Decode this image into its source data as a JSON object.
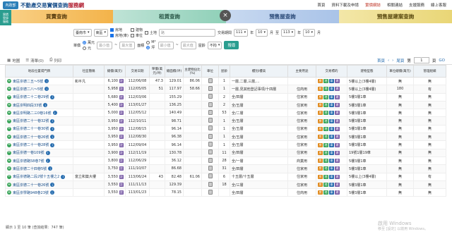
{
  "header": {
    "logo_text": "內政部",
    "title": "不動產交易實價查詢",
    "title_suffix": "服務網",
    "nav": [
      "首頁",
      "資料下載及申請",
      "實價網誌",
      "相關連結",
      "支援服務",
      "線上客服"
    ]
  },
  "tabs": [
    "買賣查詢",
    "租賃查詢",
    "預售屋查詢",
    "預售屋建案查詢"
  ],
  "side_badge": [
    "實價",
    "登錄",
    "服務"
  ],
  "filters": {
    "city": "臺南市",
    "district": "東區",
    "type_options": [
      "房地",
      "房地(車)",
      "建物",
      "車位",
      "土地"
    ],
    "type_checked": [
      true,
      true,
      false,
      false,
      false
    ],
    "address_placeholder": "路",
    "period_label": "交易期間",
    "year_from": "111",
    "month_from": "10",
    "year_to": "113",
    "month_to": "10",
    "year_unit": "年",
    "month_unit": "月",
    "to": "至",
    "unit_price_label": "單價",
    "unit_options": [
      "萬元",
      "元"
    ],
    "min_placeholder": "最小值",
    "max_placeholder": "最大值",
    "area_label": "面積",
    "area_units": [
      "M²",
      "坪"
    ],
    "age_label": "屋齡",
    "age_value": "不拘",
    "search_button": "搜尋"
  },
  "toolbar": {
    "map": "地圖",
    "list": "清單(0)",
    "print": "列印",
    "first": "首頁",
    "last": "尾頁",
    "page_label": "第",
    "page_value": "1",
    "page_unit": "頁",
    "go": "GO"
  },
  "table": {
    "headers": [
      "地段位置或門牌",
      "社區簡稱",
      "總價(萬元)",
      "交易日期",
      "單價(萬元/坪)",
      "總面積(坪)",
      "主建物佔比(%)",
      "車位",
      "屋齡",
      "樓別/樓高",
      "主要用途",
      "交易標的",
      "建物型態",
      "車位總價(萬元)",
      "管理組織"
    ],
    "rows": [
      {
        "addr": "東區崇德二五～5號",
        "comm": "和平凡",
        "total": "6,100",
        "date": "112/06/08",
        "unit": "47.3",
        "area": "129.01",
        "ratio": "86.06",
        "park": "",
        "age": "1",
        "floor": "一層,二層,三層,...",
        "use": "",
        "badges": [
          "房",
          "地",
          "車",
          "建"
        ],
        "type": "5樓以上(3樓4層)",
        "ptotal": "無",
        "mgmt": "無"
      },
      {
        "addr": "東區崇德二八～5號",
        "comm": "",
        "total": "5,958",
        "date": "112/05/05",
        "unit": "51",
        "area": "117.97",
        "ratio": "58.66",
        "park": "",
        "age": "1",
        "floor": "一層,見其他登記事項/十四層",
        "use": "住商用",
        "badges": [
          "房",
          "地",
          "車",
          "建"
        ],
        "type": "5樓以上(3樓4層)",
        "ptotal": "180",
        "mgmt": "有"
      },
      {
        "addr": "東區崇德二十二巷29號",
        "comm": "",
        "total": "5,680",
        "date": "112/03/06",
        "unit": "",
        "area": "155.29",
        "ratio": "",
        "park": "",
        "age": "2",
        "floor": "全/四層",
        "use": "住家用",
        "badges": [
          "房",
          "地",
          "車",
          "建"
        ],
        "type": "5樓3層1車",
        "ptotal": "無",
        "mgmt": "無"
      },
      {
        "addr": "東區崇明四段33號",
        "comm": "",
        "total": "5,400",
        "date": "113/01/27",
        "unit": "",
        "area": "136.25",
        "ratio": "",
        "park": "",
        "age": "2",
        "floor": "全/五層",
        "use": "住家用",
        "badges": [
          "房",
          "地",
          "車",
          "建"
        ],
        "type": "5樓3層1車",
        "ptotal": "無",
        "mgmt": "無"
      },
      {
        "addr": "東區崇明路二三0巷16號",
        "comm": "",
        "total": "5,000",
        "date": "112/05/12",
        "unit": "",
        "area": "140.49",
        "ratio": "",
        "park": "",
        "age": "53",
        "floor": "全/二層",
        "use": "住家用",
        "badges": [
          "房",
          "地",
          "車",
          "建"
        ],
        "type": "5樓3層1車",
        "ptotal": "無",
        "mgmt": "無"
      },
      {
        "addr": "東區崇德二十一巷32號",
        "comm": "",
        "total": "3,950",
        "date": "112/10/11",
        "unit": "",
        "area": "98.71",
        "ratio": "",
        "park": "",
        "age": "1",
        "floor": "全/五層",
        "use": "住家用",
        "badges": [
          "房",
          "地",
          "車",
          "建"
        ],
        "type": "5樓3層1車",
        "ptotal": "無",
        "mgmt": "無"
      },
      {
        "addr": "東區崇德二十一巷30號",
        "comm": "",
        "total": "3,950",
        "date": "112/08/15",
        "unit": "",
        "area": "96.14",
        "ratio": "",
        "park": "",
        "age": "1",
        "floor": "全/五層",
        "use": "住家用",
        "badges": [
          "房",
          "地",
          "車",
          "建"
        ],
        "type": "5樓3層1車",
        "ptotal": "無",
        "mgmt": "無"
      },
      {
        "addr": "東區崇德二十一巷26號",
        "comm": "",
        "total": "3,950",
        "date": "112/08/30",
        "unit": "",
        "area": "96.38",
        "ratio": "",
        "park": "",
        "age": "1",
        "floor": "全/五層",
        "use": "住家用",
        "badges": [
          "房",
          "地",
          "車",
          "建"
        ],
        "type": "5樓3層1車",
        "ptotal": "無",
        "mgmt": "無"
      },
      {
        "addr": "東區崇德二十一巷28號",
        "comm": "",
        "total": "3,950",
        "date": "112/09/04",
        "unit": "",
        "area": "96.14",
        "ratio": "",
        "park": "",
        "age": "1",
        "floor": "全/五層",
        "use": "住家用",
        "badges": [
          "房",
          "地",
          "車",
          "建"
        ],
        "type": "5樓3層1車",
        "ptotal": "無",
        "mgmt": "無"
      },
      {
        "addr": "東區崇德一巷109號",
        "comm": "",
        "total": "3,900",
        "date": "112/11/19",
        "unit": "",
        "area": "130.78",
        "ratio": "",
        "park": "",
        "age": "11",
        "floor": "全/四層",
        "use": "住家用",
        "badges": [
          "房",
          "地",
          "車",
          "建"
        ],
        "type": "19號1層19車",
        "ptotal": "無",
        "mgmt": "無"
      },
      {
        "addr": "東區崇德路58巷7號",
        "comm": "",
        "total": "3,800",
        "date": "112/06/29",
        "unit": "",
        "area": "36.12",
        "ratio": "",
        "park": "",
        "age": "28",
        "floor": "全/一層",
        "use": "商業用",
        "badges": [
          "房",
          "地",
          "車",
          "建"
        ],
        "type": "5樓3層1車",
        "ptotal": "無",
        "mgmt": "無"
      },
      {
        "addr": "東區崇德二十四巷5號",
        "comm": "",
        "total": "3,750",
        "date": "111/10/07",
        "unit": "",
        "area": "86.68",
        "ratio": "",
        "park": "",
        "age": "31",
        "floor": "全/四層",
        "use": "住家用",
        "badges": [
          "房",
          "地",
          "車",
          "建"
        ],
        "type": "5樓3層1車",
        "ptotal": "無",
        "mgmt": "無"
      },
      {
        "addr": "東區崇德路二段2號十五樓之2",
        "comm": "富立和築大樓",
        "total": "3,550",
        "date": "113/06/24",
        "unit": "43",
        "area": "82.48",
        "ratio": "61.06",
        "park": "",
        "age": "6",
        "floor": "十五層/十五層",
        "use": "住家用",
        "badges": [
          "房",
          "地",
          "車",
          "建"
        ],
        "type": "5樓以上(3樓4層)",
        "ptotal": "無",
        "mgmt": "有"
      },
      {
        "addr": "東區崇德二十一巷26號",
        "comm": "",
        "total": "3,550",
        "date": "111/11/13",
        "unit": "",
        "area": "129.39",
        "ratio": "",
        "park": "",
        "age": "18",
        "floor": "全/三層",
        "use": "住家用",
        "badges": [
          "房",
          "地",
          "車",
          "建"
        ],
        "type": "5樓3層1車",
        "ptotal": "無",
        "mgmt": "無"
      },
      {
        "addr": "東區崇學路948巷23號",
        "comm": "",
        "total": "3,550",
        "date": "113/01/23",
        "unit": "",
        "area": "78.15",
        "ratio": "",
        "park": "",
        "age": "",
        "floor": "全/四層",
        "use": "住商用",
        "badges": [
          "房",
          "地",
          "車",
          "建"
        ],
        "type": "5樓3層1車",
        "ptotal": "無",
        "mgmt": "無"
      }
    ]
  },
  "footer": "顯示 1 至 10 筆 (查詢結果：747 筆)",
  "watermark": {
    "line1": "啟用 Windows",
    "line2": "移至 [設定] 以啟用 Windows。"
  }
}
